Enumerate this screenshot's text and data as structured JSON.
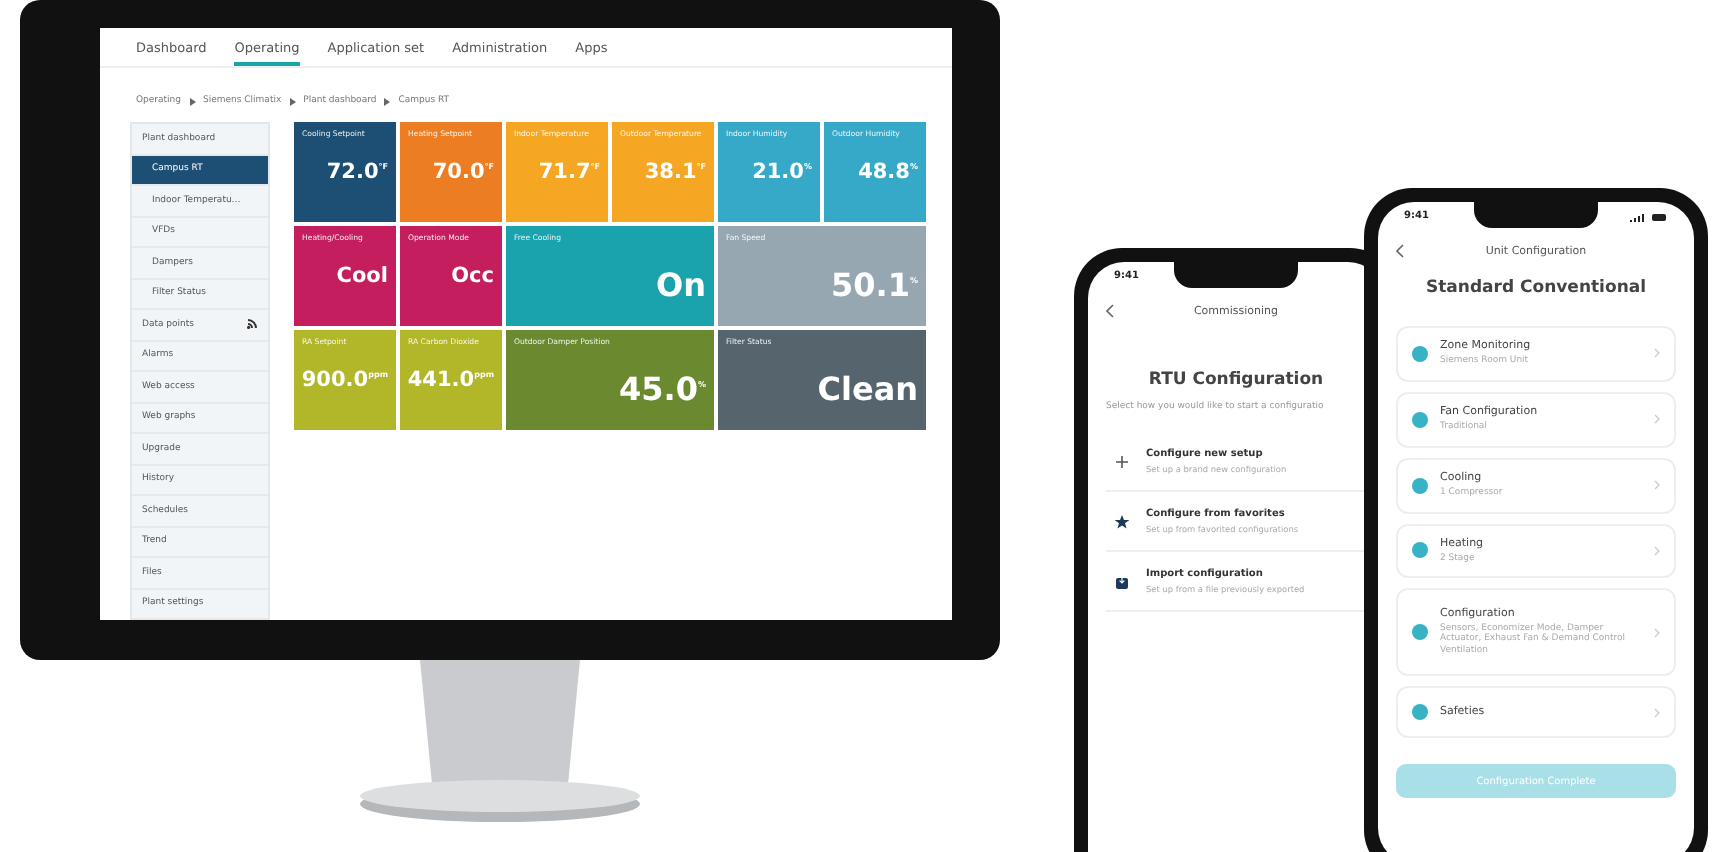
{
  "desktop": {
    "nav": [
      {
        "label": "Dashboard",
        "selected": false
      },
      {
        "label": "Operating",
        "selected": true
      },
      {
        "label": "Application set",
        "selected": false
      },
      {
        "label": "Administration",
        "selected": false
      },
      {
        "label": "Apps",
        "selected": false
      }
    ],
    "breadcrumb": [
      "Operating",
      "Siemens Climatix",
      "Plant dashboard",
      "Campus RT"
    ],
    "sidebar": [
      {
        "label": "Plant dashboard",
        "selected": false,
        "children": [
          {
            "label": "Campus RT",
            "selected": true
          },
          {
            "label": "Indoor Temperatu…",
            "selected": false
          },
          {
            "label": "VFDs",
            "selected": false
          },
          {
            "label": "Dampers",
            "selected": false
          },
          {
            "label": "Filter Status",
            "selected": false
          }
        ]
      },
      {
        "label": "Data points",
        "selected": false,
        "kind": "icon"
      },
      {
        "label": "Alarms",
        "selected": false
      },
      {
        "label": "Web access",
        "selected": false
      },
      {
        "label": "Web graphs",
        "selected": false
      },
      {
        "label": "Upgrade",
        "selected": false
      },
      {
        "label": "History",
        "selected": false
      },
      {
        "label": "Schedules",
        "selected": false
      },
      {
        "label": "Trend",
        "selected": false
      },
      {
        "label": "Files",
        "selected": false
      },
      {
        "label": "Plant settings",
        "selected": false
      }
    ],
    "tiles": [
      {
        "label": "Cooling Setpoint",
        "value": "72.0",
        "unit": "°F",
        "color": "#1d4e73",
        "kind": "small"
      },
      {
        "label": "Heating Setpoint",
        "value": "70.0",
        "unit": "°F",
        "color": "#ec7d22",
        "kind": "small"
      },
      {
        "label": "Indoor Temperature",
        "value": "71.7",
        "unit": "°F",
        "color": "#f5a623",
        "kind": "small"
      },
      {
        "label": "Outdoor Temperature",
        "value": "38.1",
        "unit": "°F",
        "color": "#f5a623",
        "kind": "small"
      },
      {
        "label": "Indoor Humidity",
        "value": "21.0",
        "unit": "%",
        "color": "#36a9c9",
        "kind": "small"
      },
      {
        "label": "Outdoor Humidity",
        "value": "48.8",
        "unit": "%",
        "color": "#36a9c9",
        "kind": "small"
      },
      {
        "label": "Heating/Cooling",
        "value": "Cool",
        "color": "#c41e5f",
        "kind": "small"
      },
      {
        "label": "Operation Mode",
        "value": "Occ",
        "color": "#c41e5f",
        "kind": "small"
      },
      {
        "label": "Free Cooling",
        "value": "On",
        "color": "#1ba3ad",
        "kind": "wide"
      },
      {
        "label": "Fan Speed",
        "value": "50.1",
        "unit": "%",
        "color": "#97a7b1",
        "kind": "wide"
      },
      {
        "label": "RA Setpoint",
        "value": "900.0",
        "unit": "ppm",
        "color": "#b2b72a",
        "kind": "small"
      },
      {
        "label": "RA Carbon Dioxide",
        "value": "441.0",
        "unit": "ppm",
        "color": "#b2b72a",
        "kind": "small"
      },
      {
        "label": "Outdoor Damper Position",
        "value": "45.0",
        "unit": "%",
        "color": "#6b8a2f",
        "kind": "wide"
      },
      {
        "label": "Filter Status",
        "value": "Clean",
        "color": "#56646d",
        "kind": "wide"
      }
    ]
  },
  "phone_commissioning": {
    "time": "9:41",
    "title": "Commissioning",
    "heading": "RTU Configuration",
    "intro": "Select how you would like to start a configuratio",
    "options": [
      {
        "kind": "plus",
        "title": "Configure new setup",
        "subtitle": "Set up a brand new configuration"
      },
      {
        "kind": "star",
        "title": "Configure from favorites",
        "subtitle": "Set up from favorited configurations"
      },
      {
        "kind": "import",
        "title": "Import configuration",
        "subtitle": "Set up from a file previously exported"
      }
    ]
  },
  "phone_unit": {
    "time": "9:41",
    "title": "Unit Configuration",
    "heading": "Standard Conventional",
    "items": [
      {
        "title": "Zone Monitoring",
        "subtitle": "Siemens Room Unit"
      },
      {
        "title": "Fan Configuration",
        "subtitle": "Traditional"
      },
      {
        "title": "Cooling",
        "subtitle": "1 Compressor"
      },
      {
        "title": "Heating",
        "subtitle": "2 Stage"
      },
      {
        "title": "Configuration",
        "subtitle": "Sensors, Economizer Mode, Damper Actuator, Exhaust Fan & Demand Control Ventilation"
      },
      {
        "title": "Safeties"
      }
    ],
    "button": {
      "label": "Configuration Complete",
      "disabled": true
    }
  }
}
